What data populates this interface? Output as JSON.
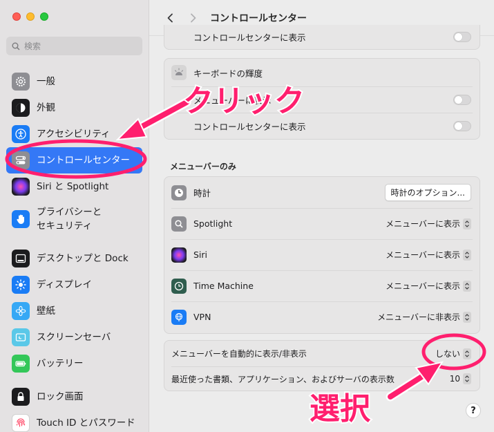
{
  "window": {
    "title": "コントロールセンター"
  },
  "search": {
    "placeholder": "検索"
  },
  "sidebar": {
    "items": [
      {
        "label": "一般",
        "icon": "gear-icon"
      },
      {
        "label": "外観",
        "icon": "appearance-icon"
      },
      {
        "label": "アクセシビリティ",
        "icon": "accessibility-icon"
      },
      {
        "label": "コントロールセンター",
        "icon": "control-center-icon",
        "active": true
      },
      {
        "label": "Siri と Spotlight",
        "icon": "siri-icon"
      },
      {
        "label": "プライバシーと\nセキュリティ",
        "icon": "hand-icon"
      },
      {
        "label": "デスクトップと Dock",
        "icon": "dock-icon"
      },
      {
        "label": "ディスプレイ",
        "icon": "display-icon"
      },
      {
        "label": "壁紙",
        "icon": "wallpaper-icon"
      },
      {
        "label": "スクリーンセーバ",
        "icon": "screensaver-icon"
      },
      {
        "label": "バッテリー",
        "icon": "battery-icon"
      },
      {
        "label": "ロック画面",
        "icon": "lock-icon"
      },
      {
        "label": "Touch ID とパスワード",
        "icon": "fingerprint-icon"
      }
    ]
  },
  "panels": {
    "top_row": "コントロールセンターに表示",
    "keyboard": {
      "title": "キーボードの輝度",
      "row1": "メニューバーに表示",
      "row2": "コントロールセンターに表示"
    },
    "menubar_only_title": "メニューバーのみ",
    "menubar_only": [
      {
        "label": "時計",
        "control": "button",
        "value": "時計のオプション..."
      },
      {
        "label": "Spotlight",
        "control": "popup",
        "value": "メニューバーに表示"
      },
      {
        "label": "Siri",
        "control": "popup",
        "value": "メニューバーに表示"
      },
      {
        "label": "Time Machine",
        "control": "popup",
        "value": "メニューバーに表示"
      },
      {
        "label": "VPN",
        "control": "popup",
        "value": "メニューバーに非表示"
      }
    ],
    "autohide": {
      "label": "メニューバーを自動的に表示/非表示",
      "value": "しない"
    },
    "recent": {
      "label": "最近使った書類、アプリケーション、およびサーバの表示数",
      "value": "10"
    }
  },
  "help_label": "?",
  "annotations": {
    "click": "クリック",
    "select": "選択",
    "color": "#ff1f6e"
  }
}
